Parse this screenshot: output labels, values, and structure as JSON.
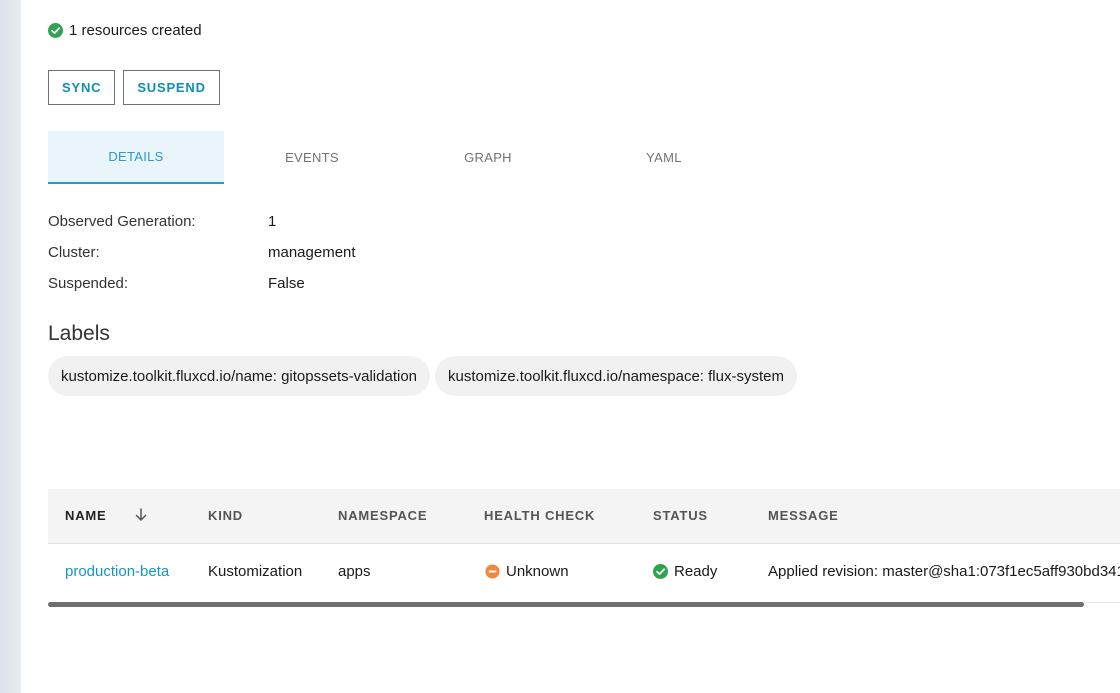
{
  "status": {
    "text": "1 resources created",
    "color": "#2ea44f"
  },
  "actions": {
    "sync_label": "SYNC",
    "suspend_label": "SUSPEND"
  },
  "tabs": [
    {
      "label": "DETAILS",
      "active": true
    },
    {
      "label": "EVENTS",
      "active": false
    },
    {
      "label": "GRAPH",
      "active": false
    },
    {
      "label": "YAML",
      "active": false
    }
  ],
  "details": [
    {
      "key": "Observed Generation:",
      "value": "1"
    },
    {
      "key": "Cluster:",
      "value": "management"
    },
    {
      "key": "Suspended:",
      "value": "False"
    }
  ],
  "labels": {
    "title": "Labels",
    "items": [
      "kustomize.toolkit.fluxcd.io/name: gitopssets-validation",
      "kustomize.toolkit.fluxcd.io/namespace: flux-system"
    ]
  },
  "table": {
    "columns": [
      "NAME",
      "KIND",
      "NAMESPACE",
      "HEALTH CHECK",
      "STATUS",
      "MESSAGE"
    ],
    "sort_icon": "arrow-down-icon",
    "rows": [
      {
        "name": "production-beta",
        "kind": "Kustomization",
        "namespace": "apps",
        "health": "Unknown",
        "status": "Ready",
        "message": "Applied revision: master@sha1:073f1ec5aff930bd341"
      }
    ]
  },
  "colors": {
    "accent": "#1596c3",
    "ok": "#2ea44f",
    "warning": "#f0883e"
  }
}
